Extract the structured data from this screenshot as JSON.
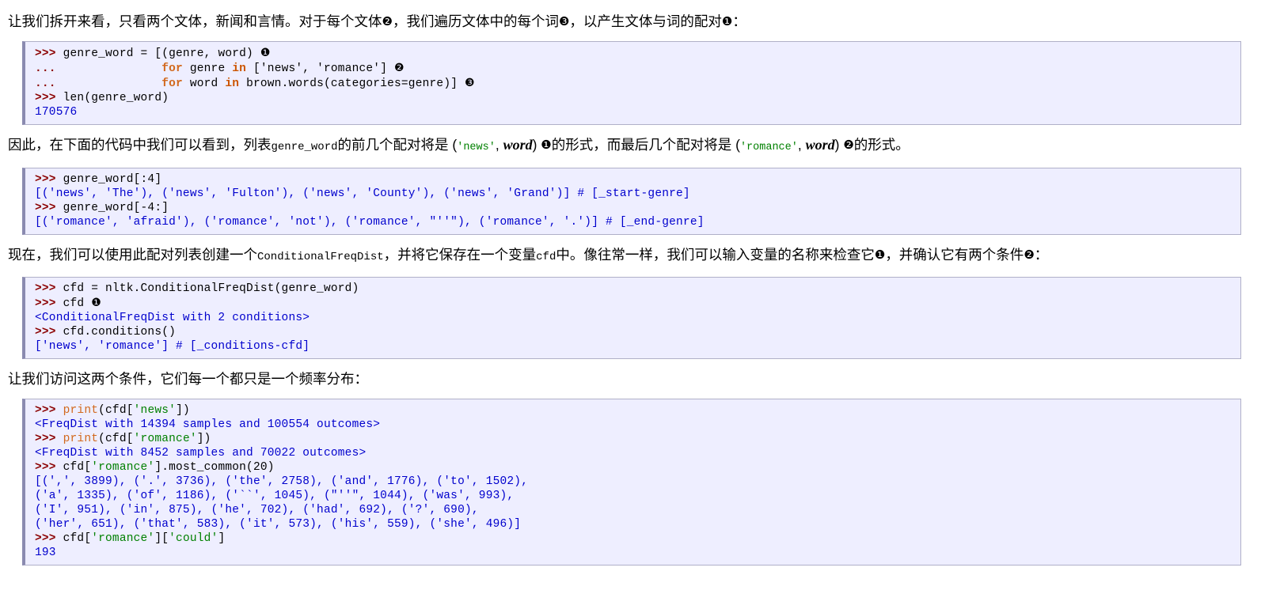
{
  "document": {
    "language": "zh-CN",
    "theme": {
      "code_bg": "#eeeeff",
      "code_border": "#b0b0c8",
      "code_left_bar": "#8a8ab0",
      "prompt_color": "#8b0000",
      "string_color": "#008000",
      "keyword_color": "#d2691e",
      "output_color": "#0000cd",
      "text_color": "#000000"
    }
  },
  "paragraphs": {
    "p1": {
      "seg1": "让我们拆开来看，只看两个文体，新闻和言情。对于每个文体",
      "mark1": "❷",
      "seg2": "，我们遍历文体中的每个词",
      "mark2": "❸",
      "seg3": "，以产生文体与词的配对",
      "mark3": "❶",
      "seg4": "："
    },
    "p2": {
      "seg1": "因此，在下面的代码中我们可以看到，列表",
      "code1": "genre_word",
      "seg2": "的前几个配对将是 (",
      "str1": "'news'",
      "seg3": ", ",
      "var1": "word",
      "seg4": ") ",
      "mark1": "❶",
      "seg5": "的形式，而最后几个配对将是 (",
      "str2": "'romance'",
      "seg6": ", ",
      "var2": "word",
      "seg7": ") ",
      "mark2": "❷",
      "seg8": "的形式。"
    },
    "p3": {
      "seg1": "现在，我们可以使用此配对列表创建一个",
      "code1": "ConditionalFreqDist",
      "seg2": "，并将它保存在一个变量",
      "code2": "cfd",
      "seg3": "中。像往常一样，我们可以输入变量的名称来检查它",
      "mark1": "❶",
      "seg4": "，并确认它有两个条件",
      "mark2": "❷",
      "seg5": "："
    },
    "p4": {
      "seg1": "让我们访问这两个条件，它们每一个都只是一个频率分布："
    }
  },
  "code_blocks": {
    "block1": {
      "name": "genre-word-construction",
      "lines": [
        {
          "prompt": ">>> ",
          "text": "genre_word = [(genre, word) ",
          "marker": "❶"
        },
        {
          "prompt": "... ",
          "indent": "              ",
          "kw": "for ",
          "text": "genre ",
          "kw2": "in ",
          "rest": "['news', 'romance'] ",
          "marker": "❷"
        },
        {
          "prompt": "... ",
          "indent": "              ",
          "kw": "for ",
          "text": "word ",
          "kw2": "in ",
          "rest": "brown.words(categories=genre)] ",
          "marker": "❸"
        },
        {
          "prompt": ">>> ",
          "text": "len(genre_word)"
        },
        {
          "output": "170576"
        }
      ]
    },
    "block2": {
      "name": "genre-word-slices",
      "lines": [
        {
          "prompt": ">>> ",
          "text": "genre_word[:4]"
        },
        {
          "output": "[('news', 'The'), ('news', 'Fulton'), ('news', 'County'), ('news', 'Grand')] # [_start-genre]"
        },
        {
          "prompt": ">>> ",
          "text": "genre_word[-4:]"
        },
        {
          "output": "[('romance', 'afraid'), ('romance', 'not'), ('romance', \"''\"), ('romance', '.')] # [_end-genre]"
        }
      ]
    },
    "block3": {
      "name": "cfd-creation",
      "lines": [
        {
          "prompt": ">>> ",
          "text": "cfd = nltk.ConditionalFreqDist(genre_word)"
        },
        {
          "prompt": ">>> ",
          "text": "cfd ",
          "marker": "❶"
        },
        {
          "output": "<ConditionalFreqDist with 2 conditions>"
        },
        {
          "prompt": ">>> ",
          "text": "cfd.conditions()"
        },
        {
          "output": "['news', 'romance'] # [_conditions-cfd]"
        }
      ]
    },
    "block4": {
      "name": "cfd-freqdist-inspection",
      "lines": [
        {
          "prompt": ">>> ",
          "fn": "print",
          "text": "(cfd[",
          "str": "'news'",
          "rest": "])"
        },
        {
          "output": "<FreqDist with 14394 samples and 100554 outcomes>"
        },
        {
          "prompt": ">>> ",
          "fn": "print",
          "text": "(cfd[",
          "str": "'romance'",
          "rest": "])"
        },
        {
          "output": "<FreqDist with 8452 samples and 70022 outcomes>"
        },
        {
          "prompt": ">>> ",
          "text": "cfd[",
          "str": "'romance'",
          "rest": "].most_common(20)"
        },
        {
          "output": "[(',', 3899), ('.', 3736), ('the', 2758), ('and', 1776), ('to', 1502),"
        },
        {
          "output2": "('a', 1335), ('of', 1186), ('``', 1045), (\"''\", 1044), ('was', 993),"
        },
        {
          "output3": "('I', 951), ('in', 875), ('he', 702), ('had', 692), ('?', 690),"
        },
        {
          "output4": "('her', 651), ('that', 583), ('it', 573), ('his', 559), ('she', 496)]"
        },
        {
          "prompt": ">>> ",
          "text": "cfd[",
          "str": "'romance'",
          "rest": "][",
          "str2": "'could'",
          "rest2": "]"
        },
        {
          "output": "193"
        }
      ]
    }
  }
}
